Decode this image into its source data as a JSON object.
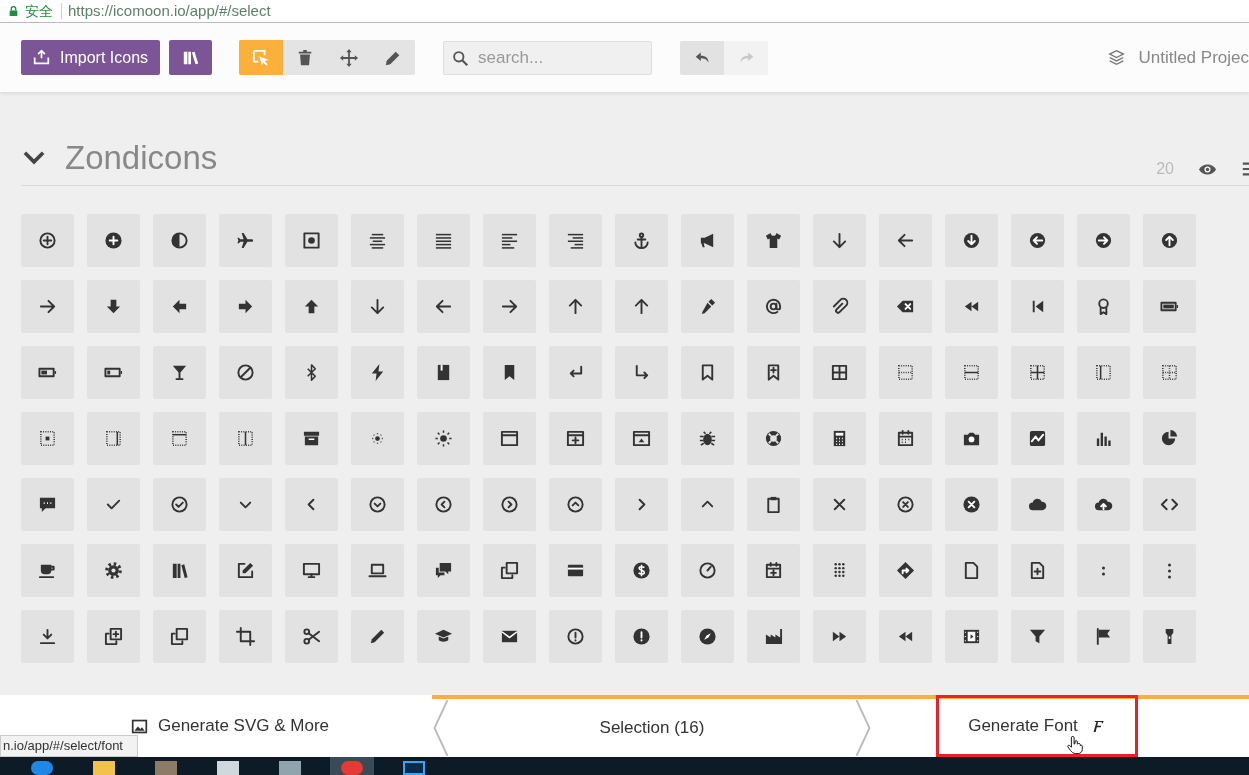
{
  "browser": {
    "secure_label": "安全",
    "url": "https://icomoon.io/app/#/select"
  },
  "toolbar": {
    "import_button": "Import Icons",
    "tools": [
      {
        "kind": "select",
        "selected": true
      },
      {
        "kind": "delete",
        "selected": false
      },
      {
        "kind": "move",
        "selected": false
      },
      {
        "kind": "edit",
        "selected": false
      }
    ],
    "search": {
      "placeholder": "search..."
    },
    "history": [
      {
        "kind": "undo",
        "disabled": false
      },
      {
        "kind": "redo",
        "disabled": true
      }
    ],
    "project_name": "Untitled Projec"
  },
  "icon_set": {
    "title": "Zondicons",
    "expanded": true,
    "count": "20",
    "icons": [
      {
        "selected": false
      },
      {
        "selected": false
      },
      {
        "selected": false
      },
      {
        "selected": false
      },
      {
        "selected": false
      },
      {
        "selected": false
      },
      {
        "selected": false
      },
      {
        "selected": false
      },
      {
        "selected": false
      },
      {
        "selected": false
      },
      {
        "selected": false
      },
      {
        "selected": false
      },
      {
        "selected": false
      },
      {
        "selected": false
      },
      {
        "selected": false
      },
      {
        "selected": false
      },
      {
        "selected": false
      },
      {
        "selected": false
      },
      {
        "selected": false
      },
      {
        "selected": false
      },
      {
        "selected": false
      },
      {
        "selected": false
      },
      {
        "selected": false
      },
      {
        "selected": false
      },
      {
        "selected": false
      },
      {
        "selected": false
      },
      {
        "selected": false
      },
      {
        "selected": false
      },
      {
        "selected": false
      },
      {
        "selected": false
      },
      {
        "selected": false
      },
      {
        "selected": false
      },
      {
        "selected": false
      },
      {
        "selected": false
      },
      {
        "selected": false
      },
      {
        "selected": false
      },
      {
        "selected": false
      },
      {
        "selected": false
      },
      {
        "selected": false
      },
      {
        "selected": false
      },
      {
        "selected": false
      },
      {
        "selected": false
      },
      {
        "selected": false
      },
      {
        "selected": false
      },
      {
        "selected": false
      },
      {
        "selected": false
      },
      {
        "selected": false
      },
      {
        "selected": false
      },
      {
        "selected": false
      },
      {
        "selected": false
      },
      {
        "selected": false
      },
      {
        "selected": false
      },
      {
        "selected": false
      },
      {
        "selected": false
      },
      {
        "selected": false
      },
      {
        "selected": false
      },
      {
        "selected": false
      },
      {
        "selected": false
      },
      {
        "selected": false
      },
      {
        "selected": false
      },
      {
        "selected": false
      },
      {
        "selected": false
      },
      {
        "selected": false
      },
      {
        "selected": false
      },
      {
        "selected": false
      },
      {
        "selected": false
      },
      {
        "selected": false
      },
      {
        "selected": false
      },
      {
        "selected": false
      },
      {
        "selected": false
      },
      {
        "selected": false
      },
      {
        "selected": false
      },
      {
        "selected": false
      },
      {
        "selected": false
      },
      {
        "selected": false
      },
      {
        "selected": false
      },
      {
        "selected": false
      },
      {
        "selected": false
      },
      {
        "selected": false
      },
      {
        "selected": false
      },
      {
        "selected": false
      },
      {
        "selected": false
      },
      {
        "selected": false
      },
      {
        "selected": false
      },
      {
        "selected": false
      },
      {
        "selected": false
      },
      {
        "selected": false
      },
      {
        "selected": false
      },
      {
        "selected": false
      },
      {
        "selected": false
      },
      {
        "selected": false
      },
      {
        "selected": false
      },
      {
        "selected": false
      },
      {
        "selected": false
      },
      {
        "selected": false
      },
      {
        "selected": false
      },
      {
        "selected": false
      },
      {
        "selected": false
      },
      {
        "selected": false
      },
      {
        "selected": false
      },
      {
        "selected": false
      },
      {
        "selected": false
      },
      {
        "selected": false
      },
      {
        "selected": false
      },
      {
        "selected": false
      },
      {
        "selected": false
      },
      {
        "selected": false
      },
      {
        "selected": false
      },
      {
        "selected": false
      },
      {
        "selected": false
      },
      {
        "selected": false
      },
      {
        "selected": false
      },
      {
        "selected": false
      },
      {
        "selected": false
      },
      {
        "selected": false
      },
      {
        "selected": false
      },
      {
        "selected": false
      },
      {
        "selected": false
      },
      {
        "selected": false
      },
      {
        "selected": false
      },
      {
        "selected": false
      },
      {
        "selected": false
      },
      {
        "selected": false
      },
      {
        "selected": false
      },
      {
        "selected": false
      },
      {
        "selected": false
      }
    ]
  },
  "bottom_bar": {
    "svg_button": "Generate SVG & More",
    "selection": "Selection (16)",
    "font_button": "Generate Font",
    "highlighted": true
  },
  "status_url": "n.io/app/#/select/font",
  "taskbar": {
    "apps": [
      {
        "kind": "start",
        "selected": false
      },
      {
        "kind": "folder",
        "selected": false
      },
      {
        "kind": "app",
        "selected": false
      },
      {
        "kind": "editor",
        "selected": false
      },
      {
        "kind": "notes",
        "selected": false
      },
      {
        "kind": "browser",
        "selected": true
      },
      {
        "kind": "ps",
        "selected": false
      }
    ]
  }
}
